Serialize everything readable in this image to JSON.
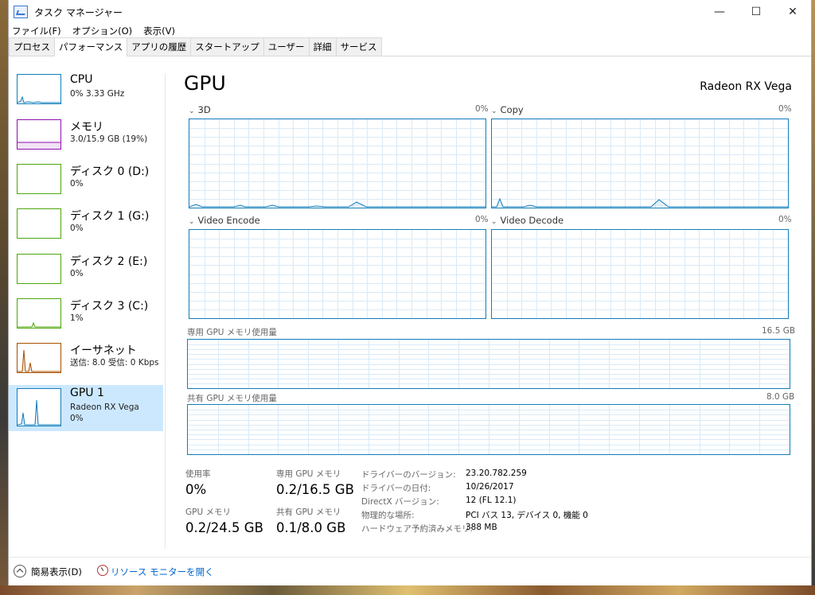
{
  "window": {
    "title": "タスク マネージャー",
    "minimize": "—",
    "maximize": "☐",
    "close": "✕"
  },
  "menu": [
    "ファイル(F)",
    "オプション(O)",
    "表示(V)"
  ],
  "tabs": [
    "プロセス",
    "パフォーマンス",
    "アプリの履歴",
    "スタートアップ",
    "ユーザー",
    "詳細",
    "サービス"
  ],
  "active_tab": "パフォーマンス",
  "sidebar": [
    {
      "title": "CPU",
      "sub": "0% 3.33 GHz",
      "color": "#117dbb"
    },
    {
      "title": "メモリ",
      "sub": "3.0/15.9 GB (19%)",
      "color": "#8b12ae"
    },
    {
      "title": "ディスク 0 (D:)",
      "sub": "0%",
      "color": "#4da60c"
    },
    {
      "title": "ディスク 1 (G:)",
      "sub": "0%",
      "color": "#4da60c"
    },
    {
      "title": "ディスク 2 (E:)",
      "sub": "0%",
      "color": "#4da60c"
    },
    {
      "title": "ディスク 3 (C:)",
      "sub": "1%",
      "color": "#4da60c"
    },
    {
      "title": "イーサネット",
      "sub": "送信: 8.0 受信: 0 Kbps",
      "color": "#a74f01"
    },
    {
      "title": "GPU 1",
      "sub": "Radeon RX Vega",
      "sub2": "0%",
      "color": "#117dbb"
    }
  ],
  "main": {
    "title": "GPU",
    "gpu_name": "Radeon RX Vega",
    "engines": [
      {
        "name": "3D",
        "pct": "0%"
      },
      {
        "name": "Copy",
        "pct": "0%"
      },
      {
        "name": "Video Encode",
        "pct": "0%"
      },
      {
        "name": "Video Decode",
        "pct": "0%"
      }
    ],
    "dedicated": {
      "label": "専用 GPU メモリ使用量",
      "max": "16.5 GB"
    },
    "shared": {
      "label": "共有 GPU メモリ使用量",
      "max": "8.0 GB"
    },
    "stats": [
      {
        "label": "使用率",
        "value": "0%"
      },
      {
        "label": "専用 GPU メモリ",
        "value": "0.2/16.5 GB"
      },
      {
        "label": "GPU メモリ",
        "value": "0.2/24.5 GB"
      },
      {
        "label": "共有 GPU メモリ",
        "value": "0.1/8.0 GB"
      }
    ],
    "info": [
      {
        "label": "ドライバーのバージョン:",
        "value": "23.20.782.259"
      },
      {
        "label": "ドライバーの日付:",
        "value": "10/26/2017"
      },
      {
        "label": "DirectX バージョン:",
        "value": "12 (FL 12.1)"
      },
      {
        "label": "物理的な場所:",
        "value": "PCI バス 13, デバイス 0, 機能 0"
      },
      {
        "label": "ハードウェア予約済みメモリ:",
        "value": "388 MB"
      }
    ]
  },
  "footer": {
    "simple": "簡易表示(D)",
    "resource_monitor": "リソース モニターを開く"
  },
  "colors": {
    "graph_line": "#117dbb",
    "grid": "#d9eaf7",
    "selected": "#cce8ff",
    "link": "#0066cc"
  }
}
